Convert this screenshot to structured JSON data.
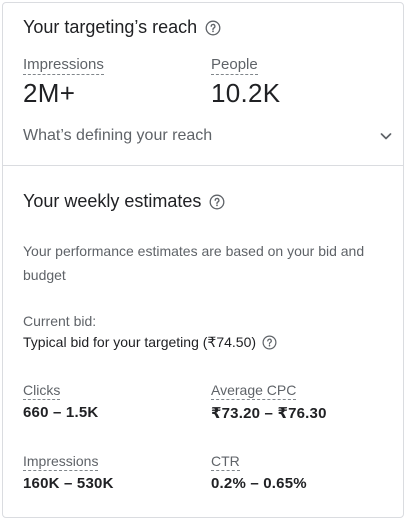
{
  "reach": {
    "title": "Your targeting’s reach",
    "impressions_label": "Impressions",
    "impressions_value": "2M+",
    "people_label": "People",
    "people_value": "10.2K",
    "defining_label": "What’s defining your reach"
  },
  "estimates": {
    "title": "Your weekly estimates",
    "description": "Your performance estimates are based on your bid and budget",
    "current_bid_label": "Current bid:",
    "typical_bid": "Typical bid for your targeting (₹74.50)",
    "metrics": [
      {
        "label": "Clicks",
        "value": "660 – 1.5K"
      },
      {
        "label": "Average CPC",
        "value": "₹73.20 – ₹76.30"
      },
      {
        "label": "Impressions",
        "value": "160K – 530K"
      },
      {
        "label": "CTR",
        "value": "0.2% – 0.65%"
      }
    ]
  },
  "icons": {
    "help": "help-circle-icon",
    "expand": "chevron-down-icon"
  },
  "colors": {
    "text_primary": "#202124",
    "text_secondary": "#5f6368",
    "divider": "#dadce0"
  }
}
